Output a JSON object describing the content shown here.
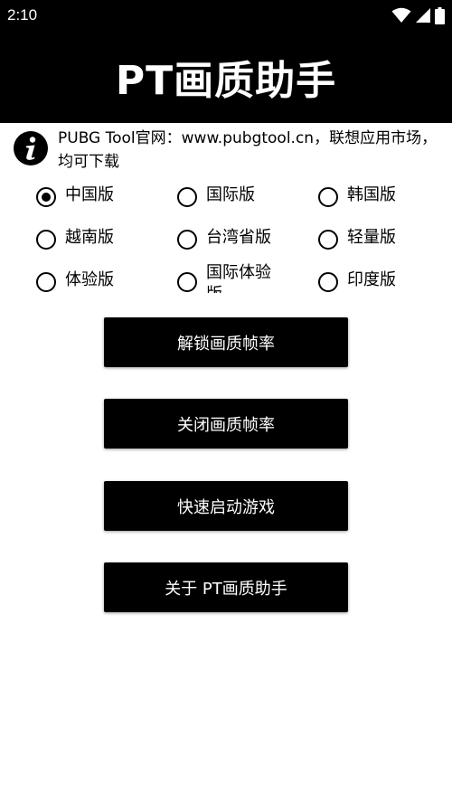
{
  "status_bar": {
    "time": "2:10",
    "icons": [
      "wifi-icon",
      "signal-icon",
      "battery-icon"
    ]
  },
  "header": {
    "title": "PT画质助手"
  },
  "notice": {
    "icon": "info-icon",
    "text": "PUBG Tool官网：www.pubgtool.cn，联想应用市场，均可下载"
  },
  "regions": {
    "selected": "中国版",
    "options": [
      {
        "label": "中国版",
        "checked": true
      },
      {
        "label": "国际版",
        "checked": false
      },
      {
        "label": "韩国版",
        "checked": false
      },
      {
        "label": "越南版",
        "checked": false
      },
      {
        "label": "台湾省版",
        "checked": false
      },
      {
        "label": "轻量版",
        "checked": false
      },
      {
        "label": "体验版",
        "checked": false
      },
      {
        "label": "国际体验版",
        "checked": false
      },
      {
        "label": "印度版",
        "checked": false
      }
    ]
  },
  "actions": {
    "unlock_label": "解锁画质帧率",
    "close_label": "关闭画质帧率",
    "launch_label": "快速启动游戏",
    "about_label": "关于 PT画质助手"
  },
  "colors": {
    "bar_background": "#000000",
    "button_background": "#000000",
    "button_text": "#ffffff",
    "page_background": "#ffffff"
  }
}
